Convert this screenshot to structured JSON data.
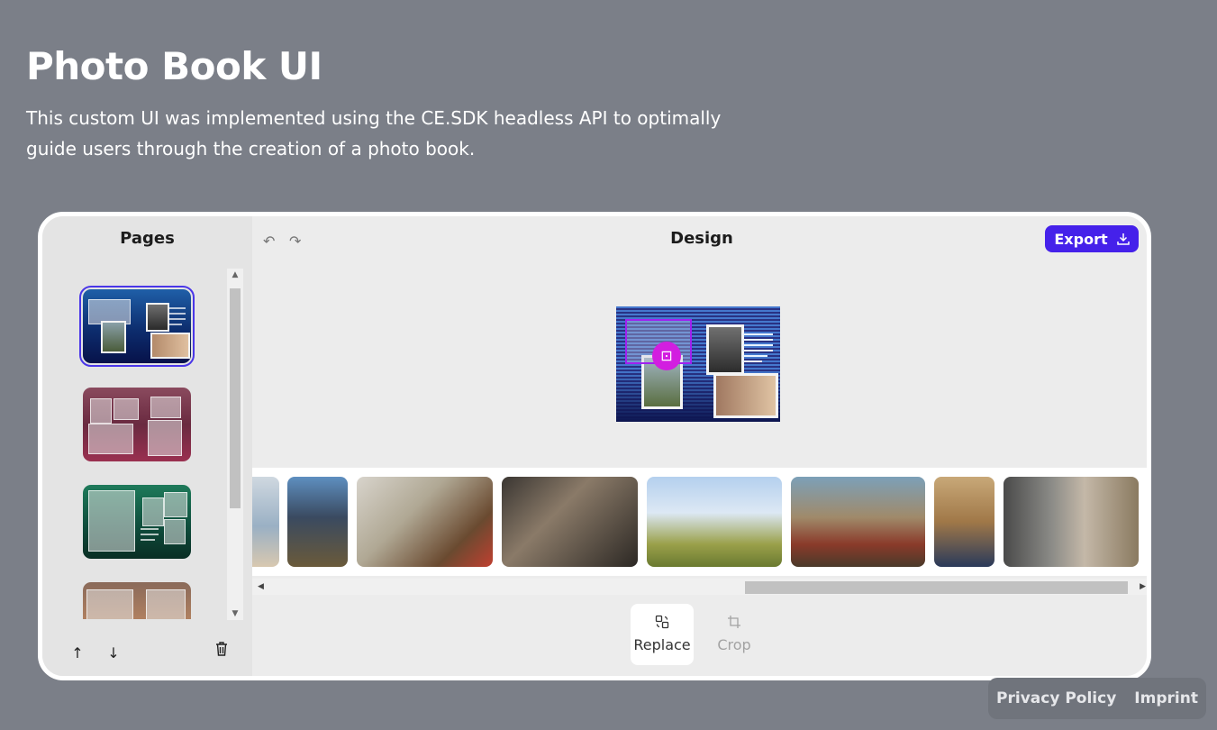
{
  "hero": {
    "title": "Photo Book UI",
    "description": "This custom UI was implemented using the CE.SDK headless API to optimally guide users through the creation of a photo book."
  },
  "pages_panel": {
    "title": "Pages",
    "page_count_visible": 4,
    "selected_index": 0
  },
  "design_panel": {
    "title": "Design",
    "export_label": "Export"
  },
  "tools": {
    "replace_label": "Replace",
    "crop_label": "Crop"
  },
  "footer": {
    "privacy_label": "Privacy Policy",
    "imprint_label": "Imprint"
  },
  "colors": {
    "page_background": "#7b7f88",
    "accent": "#4521ea",
    "selection": "#a020f0"
  },
  "icons": {
    "undo": "undo-icon",
    "redo": "redo-icon",
    "export": "download-icon",
    "move_up": "arrow-up-icon",
    "move_down": "arrow-down-icon",
    "delete": "trash-icon",
    "replace": "replace-icon",
    "crop": "crop-icon"
  }
}
